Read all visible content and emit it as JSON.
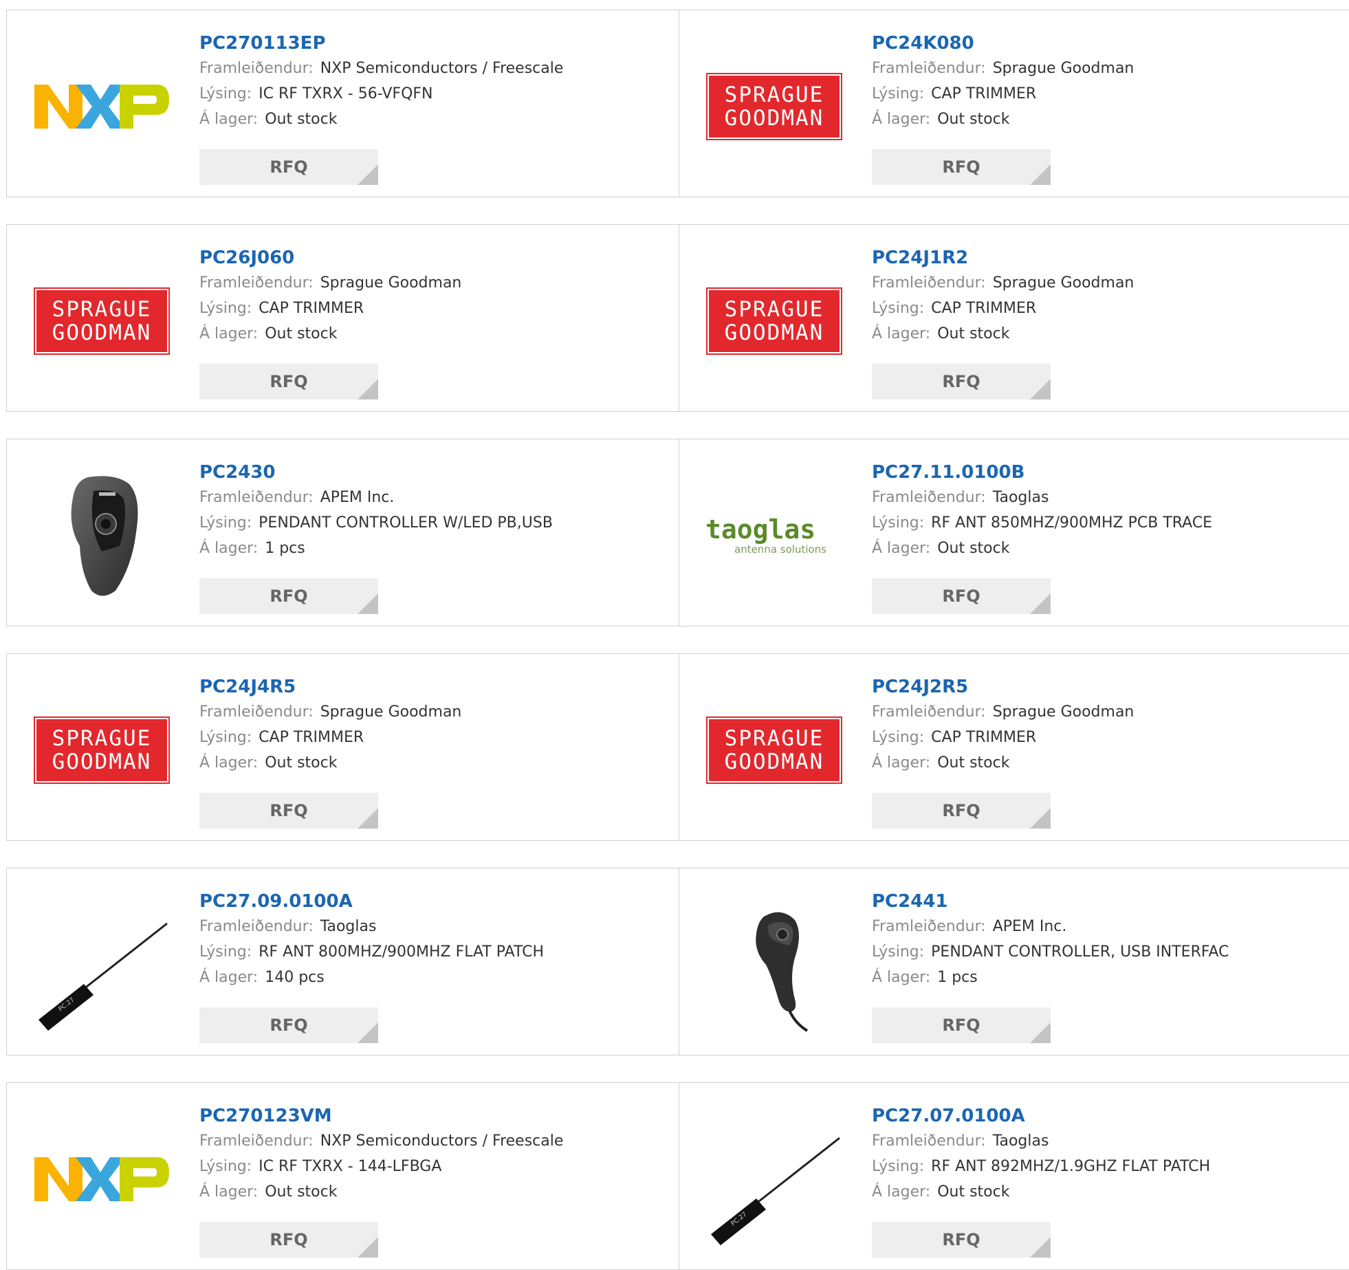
{
  "labels": {
    "manufacturer": "Framleiðendur:",
    "description": "Lýsing:",
    "stock": "Á lager:",
    "rfq": "RFQ"
  },
  "colors": {
    "part_number": "#1b66b0",
    "sprague_red": "#e2282d",
    "nxp_yellow": "#f9b300",
    "nxp_blue": "#3aa6dd",
    "nxp_green": "#c9d200"
  },
  "products": [
    {
      "part": "PC270113EP",
      "manufacturer": "NXP Semiconductors / Freescale",
      "description": "IC RF TXRX - 56-VFQFN",
      "stock": "Out stock",
      "logo": "nxp-logo"
    },
    {
      "part": "PC24K080",
      "manufacturer": "Sprague Goodman",
      "description": "CAP TRIMMER",
      "stock": "Out stock",
      "logo": "sprague-goodman-logo",
      "logo_text": [
        "SPRAGUE",
        "GOODMAN"
      ]
    },
    {
      "part": "PC26J060",
      "manufacturer": "Sprague Goodman",
      "description": "CAP TRIMMER",
      "stock": "Out stock",
      "logo": "sprague-goodman-logo",
      "logo_text": [
        "SPRAGUE",
        "GOODMAN"
      ]
    },
    {
      "part": "PC24J1R2",
      "manufacturer": "Sprague Goodman",
      "description": "CAP TRIMMER",
      "stock": "Out stock",
      "logo": "sprague-goodman-logo",
      "logo_text": [
        "SPRAGUE",
        "GOODMAN"
      ]
    },
    {
      "part": "PC2430",
      "manufacturer": "APEM Inc.",
      "description": "PENDANT CONTROLLER W/LED PB,USB",
      "stock": "1 pcs",
      "logo": "pendant-controller-image"
    },
    {
      "part": "PC27.11.0100B",
      "manufacturer": "Taoglas",
      "description": "RF ANT 850MHZ/900MHZ PCB TRACE",
      "stock": "Out stock",
      "logo": "taoglas-logo",
      "logo_text": [
        "taoglas",
        "antenna solutions"
      ]
    },
    {
      "part": "PC24J4R5",
      "manufacturer": "Sprague Goodman",
      "description": "CAP TRIMMER",
      "stock": "Out stock",
      "logo": "sprague-goodman-logo",
      "logo_text": [
        "SPRAGUE",
        "GOODMAN"
      ]
    },
    {
      "part": "PC24J2R5",
      "manufacturer": "Sprague Goodman",
      "description": "CAP TRIMMER",
      "stock": "Out stock",
      "logo": "sprague-goodman-logo",
      "logo_text": [
        "SPRAGUE",
        "GOODMAN"
      ]
    },
    {
      "part": "PC27.09.0100A",
      "manufacturer": "Taoglas",
      "description": "RF ANT 800MHZ/900MHZ FLAT PATCH",
      "stock": "140 pcs",
      "logo": "flat-patch-antenna-image"
    },
    {
      "part": "PC2441",
      "manufacturer": "APEM Inc.",
      "description": "PENDANT CONTROLLER, USB INTERFAC",
      "stock": "1 pcs",
      "logo": "handheld-controller-image"
    },
    {
      "part": "PC270123VM",
      "manufacturer": "NXP Semiconductors / Freescale",
      "description": "IC RF TXRX - 144-LFBGA",
      "stock": "Out stock",
      "logo": "nxp-logo"
    },
    {
      "part": "PC27.07.0100A",
      "manufacturer": "Taoglas",
      "description": "RF ANT 892MHZ/1.9GHZ FLAT PATCH",
      "stock": "Out stock",
      "logo": "flat-patch-antenna-image"
    }
  ]
}
